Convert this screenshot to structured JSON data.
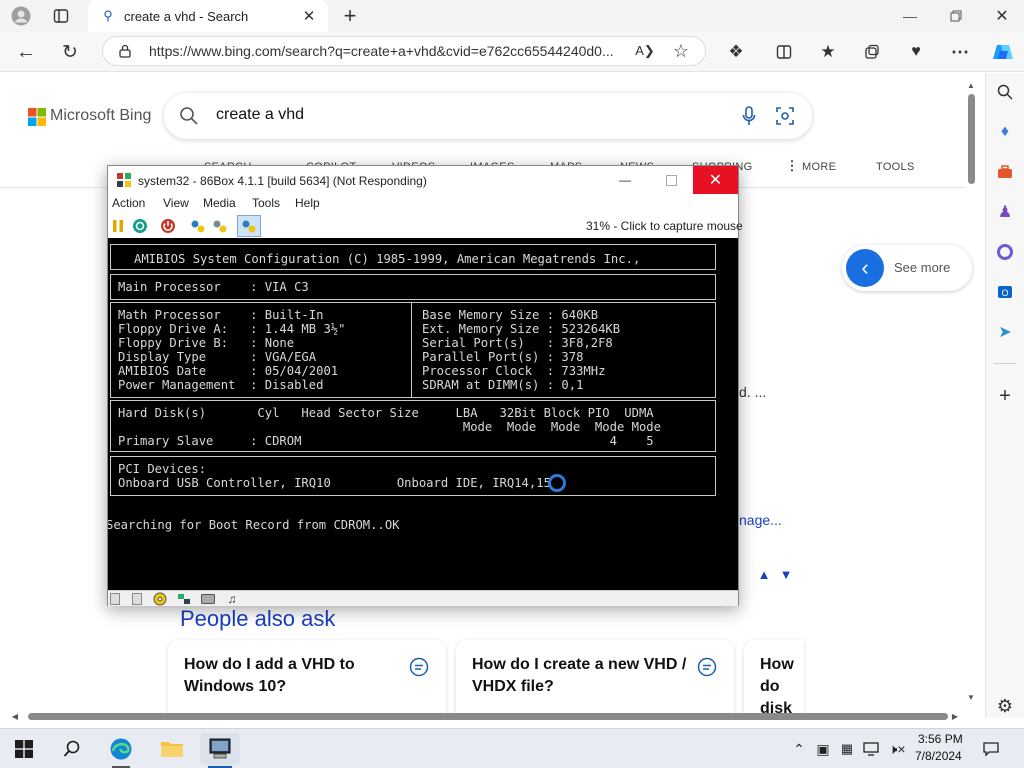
{
  "browser": {
    "tab_title": "create a vhd - Search",
    "url": "https://www.bing.com/search?q=create+a+vhd&cvid=e762cc65544240d0..."
  },
  "bing": {
    "logo_text": "Microsoft Bing",
    "query": "create a vhd",
    "nav": [
      "SEARCH",
      "COPILOT",
      "VIDEOS",
      "IMAGES",
      "MAPS",
      "NEWS",
      "SHOPPING",
      "MORE",
      "TOOLS"
    ],
    "see_more": "See more",
    "snippet_1": "d. ...",
    "snippet_2": "nage...",
    "people_also_ask": "People also ask",
    "questions": [
      "How do I add a VHD to Windows 10?",
      "How do I create a new VHD / VHDX file?",
      "How do disk (V"
    ]
  },
  "vm": {
    "title": "system32 - 86Box 4.1.1 [build 5634] (Not Responding)",
    "menu": [
      "Action",
      "View",
      "Media",
      "Tools",
      "Help"
    ],
    "capture_text": "31% - Click to capture mouse",
    "bios": {
      "header": "AMIBIOS System Configuration (C) 1985-1999, American Megatrends Inc.,",
      "main_processor": "Main Processor    : VIA C3",
      "left": [
        "Math Processor    : Built-In",
        "Floppy Drive A:   : 1.44 MB 3½\"",
        "Floppy Drive B:   : None",
        "Display Type      : VGA/EGA",
        "AMIBIOS Date      : 05/04/2001",
        "Power Management  : Disabled"
      ],
      "right": [
        "Base Memory Size : 640KB",
        "Ext. Memory Size : 523264KB",
        "Serial Port(s)   : 3F8,2F8",
        "Parallel Port(s) : 378",
        "Processor Clock  : 733MHz",
        "SDRAM at DIMM(s) : 0,1"
      ],
      "disk_header_1": "Hard Disk(s)       Cyl   Head Sector Size     LBA   32Bit Block PIO  UDMA",
      "disk_header_2": "                                               Mode  Mode  Mode  Mode Mode",
      "disk_header_3": "                                                                   4    5",
      "disk_row": "Primary Slave     : CDROM",
      "pci_1": "PCI Devices:",
      "pci_2": "Onboard USB Controller, IRQ10         Onboard IDE, IRQ14,15",
      "boot": "Searching for Boot Record from CDROM..OK"
    }
  },
  "taskbar": {
    "time": "3:56 PM",
    "date": "7/8/2024"
  },
  "colors": {
    "accent": "#0067b8",
    "close_red": "#e81123",
    "bing_blue": "#174ae4"
  }
}
